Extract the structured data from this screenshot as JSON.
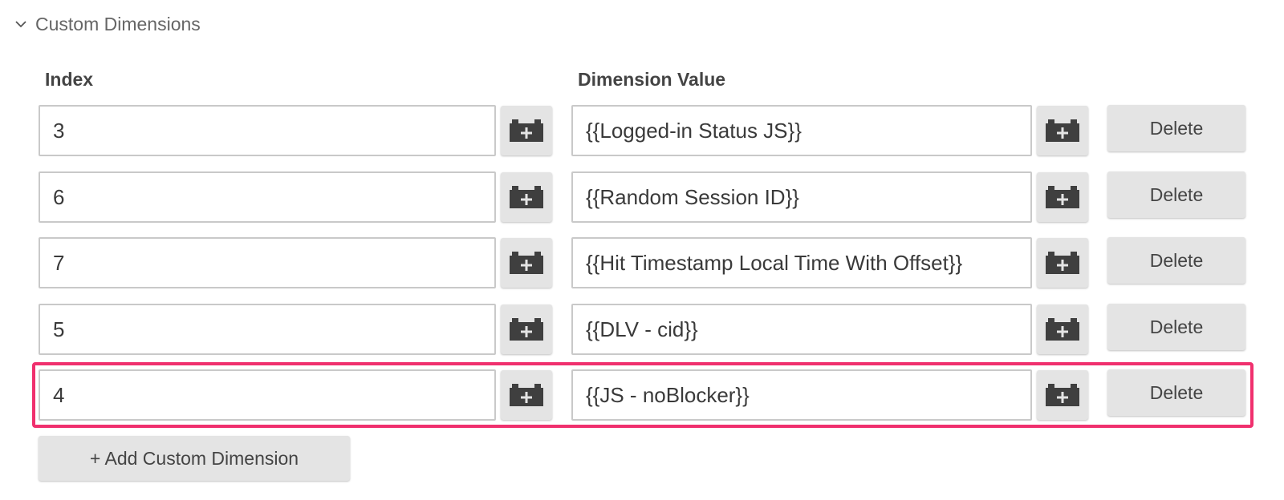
{
  "section": {
    "title": "Custom Dimensions",
    "expanded": true
  },
  "columns": {
    "index_label": "Index",
    "value_label": "Dimension Value"
  },
  "rows": [
    {
      "index": "3",
      "value": "{{Logged-in Status JS}}",
      "delete_label": "Delete"
    },
    {
      "index": "6",
      "value": "{{Random Session ID}}",
      "delete_label": "Delete"
    },
    {
      "index": "7",
      "value": "{{Hit Timestamp Local Time With Offset}}",
      "delete_label": "Delete"
    },
    {
      "index": "5",
      "value": "{{DLV - cid}}",
      "delete_label": "Delete"
    },
    {
      "index": "4",
      "value": "{{JS - noBlocker}}",
      "delete_label": "Delete",
      "highlighted": true
    }
  ],
  "add_button": {
    "label": "+ Add Custom Dimension"
  },
  "colors": {
    "highlight": "#f0306e",
    "button_bg": "#e4e4e4",
    "icon": "#3f3f3f"
  },
  "icons": {
    "variable_picker": "brick-plus-icon",
    "collapse": "chevron-down-icon"
  }
}
